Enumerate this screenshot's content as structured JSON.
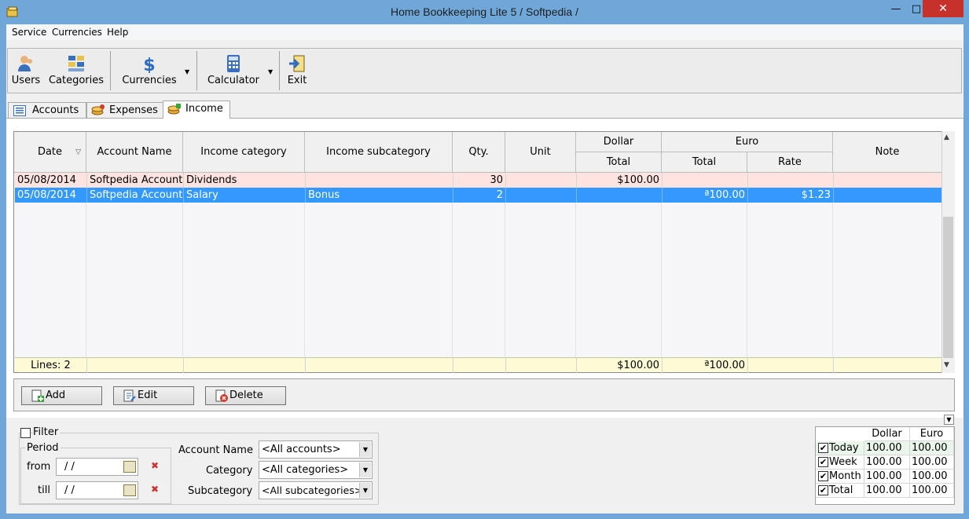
{
  "window": {
    "title": "Home Bookkeeping Lite 5  / Softpedia /",
    "minimize": "—",
    "maximize": "□",
    "close": "✕"
  },
  "menu": [
    "Service",
    "Currencies",
    "Help"
  ],
  "toolbar": {
    "users": "Users",
    "categories": "Categories",
    "currencies": "Currencies",
    "calculator": "Calculator",
    "exit": "Exit"
  },
  "tabs": [
    {
      "label": "Accounts",
      "active": false
    },
    {
      "label": "Expenses",
      "active": false
    },
    {
      "label": "Income",
      "active": true
    }
  ],
  "grid": {
    "headers": {
      "date": "Date",
      "account_name": "Account Name",
      "income_category": "Income category",
      "income_subcategory": "Income subcategory",
      "qty": "Qty.",
      "unit": "Unit",
      "dollar": "Dollar",
      "dollar_total": "Total",
      "euro": "Euro",
      "euro_total": "Total",
      "euro_rate": "Rate",
      "note": "Note"
    },
    "rows": [
      {
        "date": "05/08/2014",
        "account": "Softpedia Account",
        "category": "Dividends",
        "subcategory": "",
        "qty": "30",
        "unit": "",
        "dollar_total": "$100.00",
        "euro_total": "",
        "rate": "",
        "note": "",
        "selected": false
      },
      {
        "date": "05/08/2014",
        "account": "Softpedia Account",
        "category": "Salary",
        "subcategory": "Bonus",
        "qty": "2",
        "unit": "",
        "dollar_total": "",
        "euro_total": "ª100.00",
        "rate": "$1.23",
        "note": "",
        "selected": true
      }
    ],
    "footer": {
      "lines": "Lines: 2",
      "dollar_total": "$100.00",
      "euro_total": "ª100.00"
    }
  },
  "actions": {
    "add": "Add",
    "edit": "Edit",
    "delete": "Delete"
  },
  "filter": {
    "label": "Filter",
    "period_label": "Period",
    "from_label": "from",
    "till_label": "till",
    "from_value": " /  /",
    "till_value": " /  /",
    "account_name_label": "Account Name",
    "account_name_value": "<All accounts>",
    "category_label": "Category",
    "category_value": "<All categories>",
    "subcategory_label": "Subcategory",
    "subcategory_value": "<All subcategories>"
  },
  "summary": {
    "headers": [
      "Dollar",
      "Euro"
    ],
    "rows": [
      {
        "label": "Today",
        "dollar": "100.00",
        "euro": "100.00"
      },
      {
        "label": "Week",
        "dollar": "100.00",
        "euro": "100.00"
      },
      {
        "label": "Month",
        "dollar": "100.00",
        "euro": "100.00"
      },
      {
        "label": "Total",
        "dollar": "100.00",
        "euro": "100.00"
      }
    ]
  },
  "colors": {
    "accent": "#3399ff",
    "row_pink": "#fde4e1",
    "footer_yellow": "#fdfbd6"
  }
}
